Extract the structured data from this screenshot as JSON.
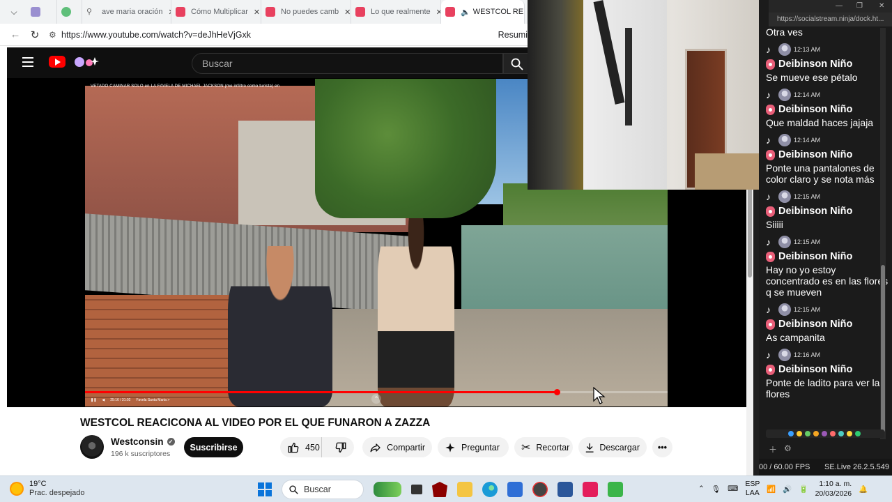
{
  "browser": {
    "tabs": [
      {
        "label": "",
        "icon": "camera-icon"
      },
      {
        "label": "",
        "icon": "green-app-icon"
      },
      {
        "label": "ave maria oración",
        "icon": "search-icon"
      },
      {
        "label": "Cómo Multiplicar",
        "icon": "youtube-icon"
      },
      {
        "label": "No puedes camb",
        "icon": "youtube-icon"
      },
      {
        "label": "Lo que realmente",
        "icon": "youtube-icon"
      },
      {
        "label": "WESTCOL RE",
        "icon": "youtube-icon",
        "active": true
      }
    ],
    "url": "https://www.youtube.com/watch?v=deJhHeVjGxk",
    "summary_label": "Resumi"
  },
  "youtube": {
    "search_placeholder": "Buscar",
    "video": {
      "overlay_title": "VETADO CAMINAR SOLO en LA FAVELA DE MICHAEL JACKSON (me infiltro como turista) en",
      "timecode": "25:16 / 31:02",
      "chapter": "Favela Santa Marta  >",
      "progress": 0.81
    },
    "title": "WESTCOL REACICONA AL VIDEO POR EL QUE FUNARON A ZAZZA",
    "channel": {
      "name": "Westconsin",
      "subscribers": "196 k suscriptores"
    },
    "subscribe_label": "Suscribirse",
    "likes": "450",
    "actions": {
      "share": "Compartir",
      "ask": "Preguntar",
      "clip": "Recortar",
      "download": "Descargar"
    }
  },
  "chat": {
    "url": "https://socialstream.ninja/dock.ht...",
    "first_text": "Otra ves",
    "messages": [
      {
        "time": "12:13 AM",
        "user": "Deibinson Niño",
        "text": "Se mueve ese pétalo"
      },
      {
        "time": "12:14 AM",
        "user": "Deibinson Niño",
        "text": "Que maldad haces jajaja"
      },
      {
        "time": "12:14 AM",
        "user": "Deibinson Niño",
        "text": "Ponte una pantalones de color claro y se nota más"
      },
      {
        "time": "12:15 AM",
        "user": "Deibinson Niño",
        "text": "Siiiii"
      },
      {
        "time": "12:15 AM",
        "user": "Deibinson Niño",
        "text": "Hay no yo estoy concentrado es en las flores q se mueven"
      },
      {
        "time": "12:15 AM",
        "user": "Deibinson Niño",
        "text": "As campanita"
      },
      {
        "time": "12:16 AM",
        "user": "Deibinson Niño",
        "text": "Ponte de ladito para ver las flores"
      }
    ],
    "fps": "00 / 60.00 FPS",
    "version": "SE.Live 26.2.5.549"
  },
  "taskbar": {
    "temperature": "19°C",
    "weather": "Prac. despejado",
    "search_label": "Buscar",
    "lang_top": "ESP",
    "lang_bottom": "LAA",
    "time": "1:10 a. m.",
    "date": "20/03/2026"
  },
  "colors": {
    "youtube_red": "#ff0000",
    "chat_badge": "#e95f79",
    "taskbar": "#dde6ef"
  }
}
